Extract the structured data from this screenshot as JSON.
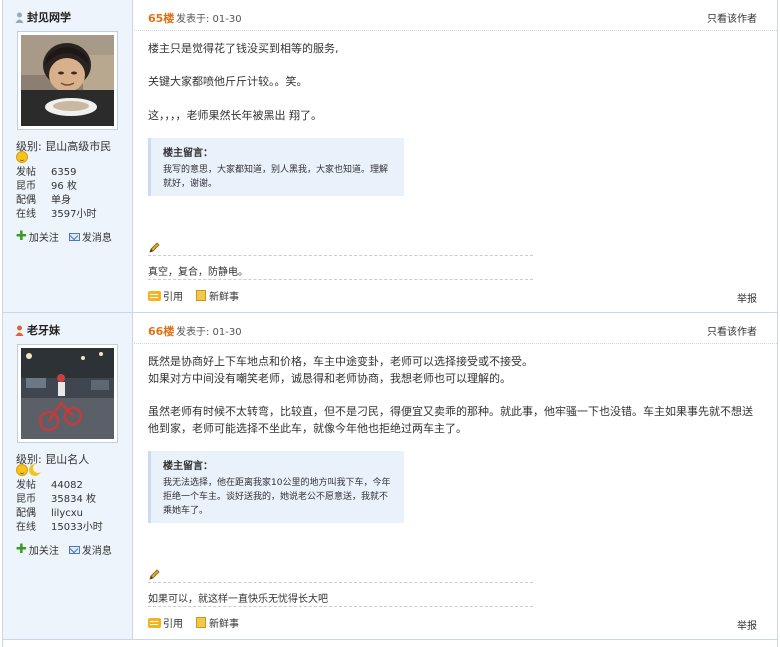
{
  "posts": [
    {
      "username": "封见网学",
      "level_label": "级别:",
      "level_value": "昆山高级市民",
      "stats": [
        {
          "k": "发帖",
          "v": "6359"
        },
        {
          "k": "昆币",
          "v": "96 枚"
        },
        {
          "k": "配偶",
          "v": "单身"
        },
        {
          "k": "在线",
          "v": "3597小时"
        }
      ],
      "follow_label": "加关注",
      "message_label": "发消息",
      "floor": "65楼",
      "posted": "发表于: 01-30",
      "only_author": "只看该作者",
      "paragraphs": [
        "楼主只是觉得花了钱没买到相等的服务,",
        "关键大家都喷他斤斤计较。。笑。",
        "这，，，，老师果然长年被黑出 翔了。"
      ],
      "quote_title": "楼主留言：",
      "quote_text": "我写的意思，大家都知道，别人黑我，大家也知道。理解就好，谢谢。",
      "signature": "真空，复合，防静电。",
      "quote_btn": "引用",
      "news_btn": "新鲜事",
      "report": "举报"
    },
    {
      "username": "老牙妹",
      "level_label": "级别:",
      "level_value": "昆山名人",
      "stats": [
        {
          "k": "发帖",
          "v": "44082"
        },
        {
          "k": "昆币",
          "v": "35834 枚"
        },
        {
          "k": "配偶",
          "v": "lilycxu"
        },
        {
          "k": "在线",
          "v": "15033小时"
        }
      ],
      "follow_label": "加关注",
      "message_label": "发消息",
      "floor": "66楼",
      "posted": "发表于: 01-30",
      "only_author": "只看该作者",
      "paragraphs": [
        "既然是协商好上下车地点和价格，车主中途变卦，老师可以选择接受或不接受。",
        "如果对方中间没有嘲笑老师，诚恳得和老师协商，我想老师也可以理解的。",
        "虽然老师有时候不太转弯，比较直，但不是刁民，得便宜又卖乖的那种。就此事，他牢骚一下也没错。车主如果事先就不想送他到家，老师可能选择不坐此车，就像今年他也拒绝过两车主了。"
      ],
      "quote_title": "楼主留言：",
      "quote_text": "我无法选择，他在距离我家10公里的地方叫我下车，今年拒绝一个车主。谈好送我的，她说老公不愿意送，我就不乘她车了。",
      "signature": "如果可以，就这样一直快乐无忧得长大吧",
      "quote_btn": "引用",
      "news_btn": "新鲜事",
      "report": "举报"
    }
  ]
}
